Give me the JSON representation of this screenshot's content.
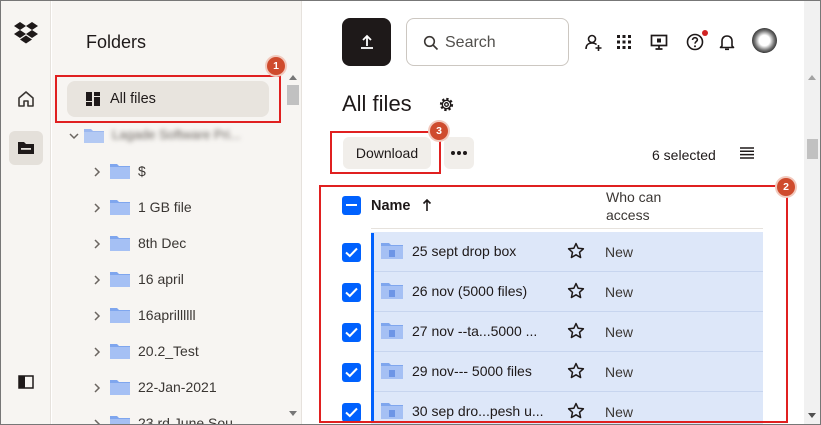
{
  "rail": {
    "icons": [
      "dropbox-logo-icon",
      "home-icon",
      "folder-icon",
      "collapse-sidebar-icon"
    ]
  },
  "tree": {
    "title": "Folders",
    "all_files_label": "All files",
    "root_label": "Lagade Software Pri...",
    "items": [
      {
        "label": "$"
      },
      {
        "label": "1 GB file"
      },
      {
        "label": "8th Dec"
      },
      {
        "label": "16 april"
      },
      {
        "label": "16aprillllll"
      },
      {
        "label": "20.2_Test"
      },
      {
        "label": "22-Jan-2021"
      },
      {
        "label": "23 rd June Sou"
      }
    ]
  },
  "toolbar": {
    "search_placeholder": "Search",
    "icons": [
      "upload-icon",
      "add-user-icon",
      "app-grid-icon",
      "desktop-icon",
      "help-icon",
      "bell-icon"
    ]
  },
  "main": {
    "title": "All files",
    "download_label": "Download",
    "selected_text": "6 selected"
  },
  "table": {
    "col_name": "Name",
    "col_access_line1": "Who can",
    "col_access_line2": "access",
    "rows": [
      {
        "name": "25 sept drop box",
        "access": "New",
        "checked": true
      },
      {
        "name": "26 nov (5000 files)",
        "access": "New",
        "checked": true
      },
      {
        "name": "27 nov --ta...5000 ...",
        "access": "New",
        "checked": true
      },
      {
        "name": "29 nov--- 5000 files",
        "access": "New",
        "checked": true
      },
      {
        "name": "30 sep dro...pesh u...",
        "access": "New",
        "checked": true
      }
    ]
  },
  "annotations": {
    "badge1": "1",
    "badge2": "2",
    "badge3": "3",
    "highlight_color": "#e02020"
  },
  "colors": {
    "accent": "#0061fe",
    "selected_row": "#dde7f9",
    "sidebar_bg": "#f7f5f2",
    "badge": "#cf4b2d"
  }
}
